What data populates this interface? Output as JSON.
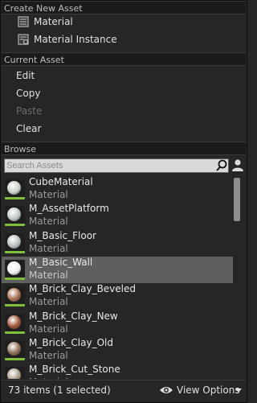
{
  "create_section": {
    "header": "Create New Asset",
    "items": [
      {
        "label": "Material",
        "icon": "material-icon"
      },
      {
        "label": "Material Instance",
        "icon": "material-instance-icon"
      }
    ]
  },
  "current_section": {
    "header": "Current Asset",
    "items": [
      {
        "label": "Edit",
        "enabled": true
      },
      {
        "label": "Copy",
        "enabled": true
      },
      {
        "label": "Paste",
        "enabled": false
      },
      {
        "label": "Clear",
        "enabled": true
      }
    ]
  },
  "browse_section": {
    "header": "Browse",
    "search_placeholder": "Search Assets",
    "assets": [
      {
        "name": "CubeMaterial",
        "type": "Material",
        "selected": false,
        "swatch": "#c8cfc8"
      },
      {
        "name": "M_AssetPlatform",
        "type": "Material",
        "selected": false,
        "swatch": "#bfc7c5"
      },
      {
        "name": "M_Basic_Floor",
        "type": "Material",
        "selected": false,
        "swatch": "#b7bcbf"
      },
      {
        "name": "M_Basic_Wall",
        "type": "Material",
        "selected": true,
        "swatch": "#f0f0f0"
      },
      {
        "name": "M_Brick_Clay_Beveled",
        "type": "Material",
        "selected": false,
        "swatch": "#a56a4a"
      },
      {
        "name": "M_Brick_Clay_New",
        "type": "Material",
        "selected": false,
        "swatch": "#9c5234"
      },
      {
        "name": "M_Brick_Clay_Old",
        "type": "Material",
        "selected": false,
        "swatch": "#8c6a54"
      },
      {
        "name": "M_Brick_Cut_Stone",
        "type": "Material",
        "selected": false,
        "swatch": "#a89a84"
      }
    ]
  },
  "footer": {
    "count_text": "73 items (1 selected)",
    "view_options_label": "View Options"
  },
  "colors": {
    "panel_bg": "#262626",
    "header_bg": "#1b1b1b",
    "selection": "#5f5f5f",
    "thumb_bar": "#7fbf3b"
  }
}
